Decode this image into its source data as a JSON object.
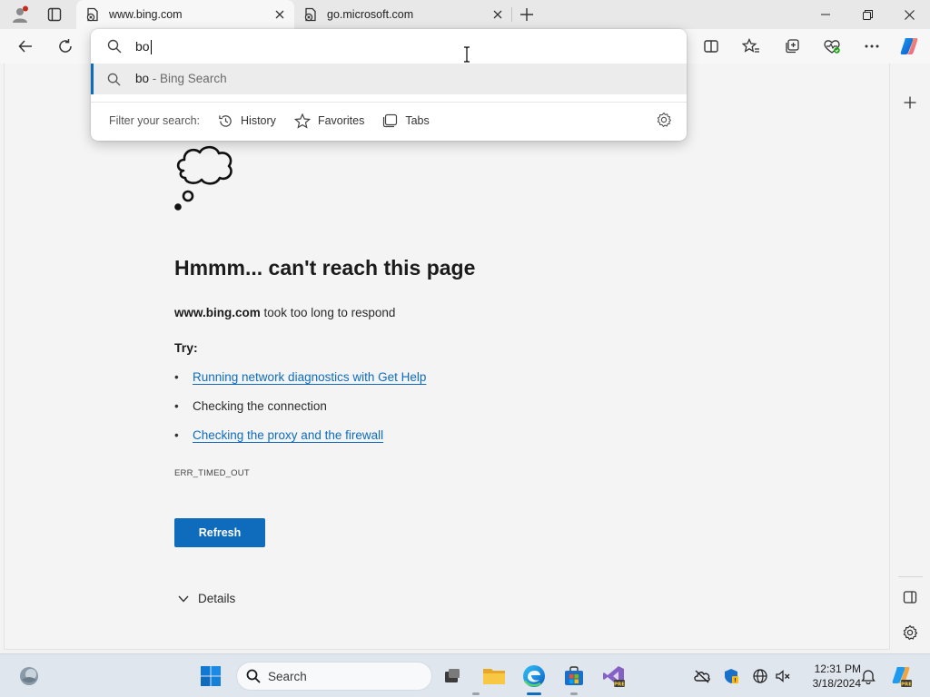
{
  "browser": {
    "tabs": [
      {
        "title": "www.bing.com",
        "active": true
      },
      {
        "title": "go.microsoft.com",
        "active": false
      }
    ]
  },
  "omnibox": {
    "query": "bo",
    "suggestion_query": "bo",
    "suggestion_suffix": " - Bing Search",
    "filter_label": "Filter your search:",
    "filters": [
      "History",
      "Favorites",
      "Tabs"
    ]
  },
  "error_page": {
    "title": "Hmmm... can't reach this page",
    "host": "www.bing.com",
    "message": " took too long to respond",
    "try_label": "Try:",
    "suggestions": [
      {
        "text": "Running network diagnostics with Get Help",
        "link": true
      },
      {
        "text": "Checking the connection",
        "link": false
      },
      {
        "text": "Checking the proxy and the firewall",
        "link": true
      }
    ],
    "error_code": "ERR_TIMED_OUT",
    "refresh_label": "Refresh",
    "details_label": "Details"
  },
  "taskbar": {
    "search_placeholder": "Search",
    "time": "12:31 PM",
    "date": "3/18/2024"
  },
  "colors": {
    "accent": "#0f6cbd",
    "link": "#0f6cbd"
  }
}
